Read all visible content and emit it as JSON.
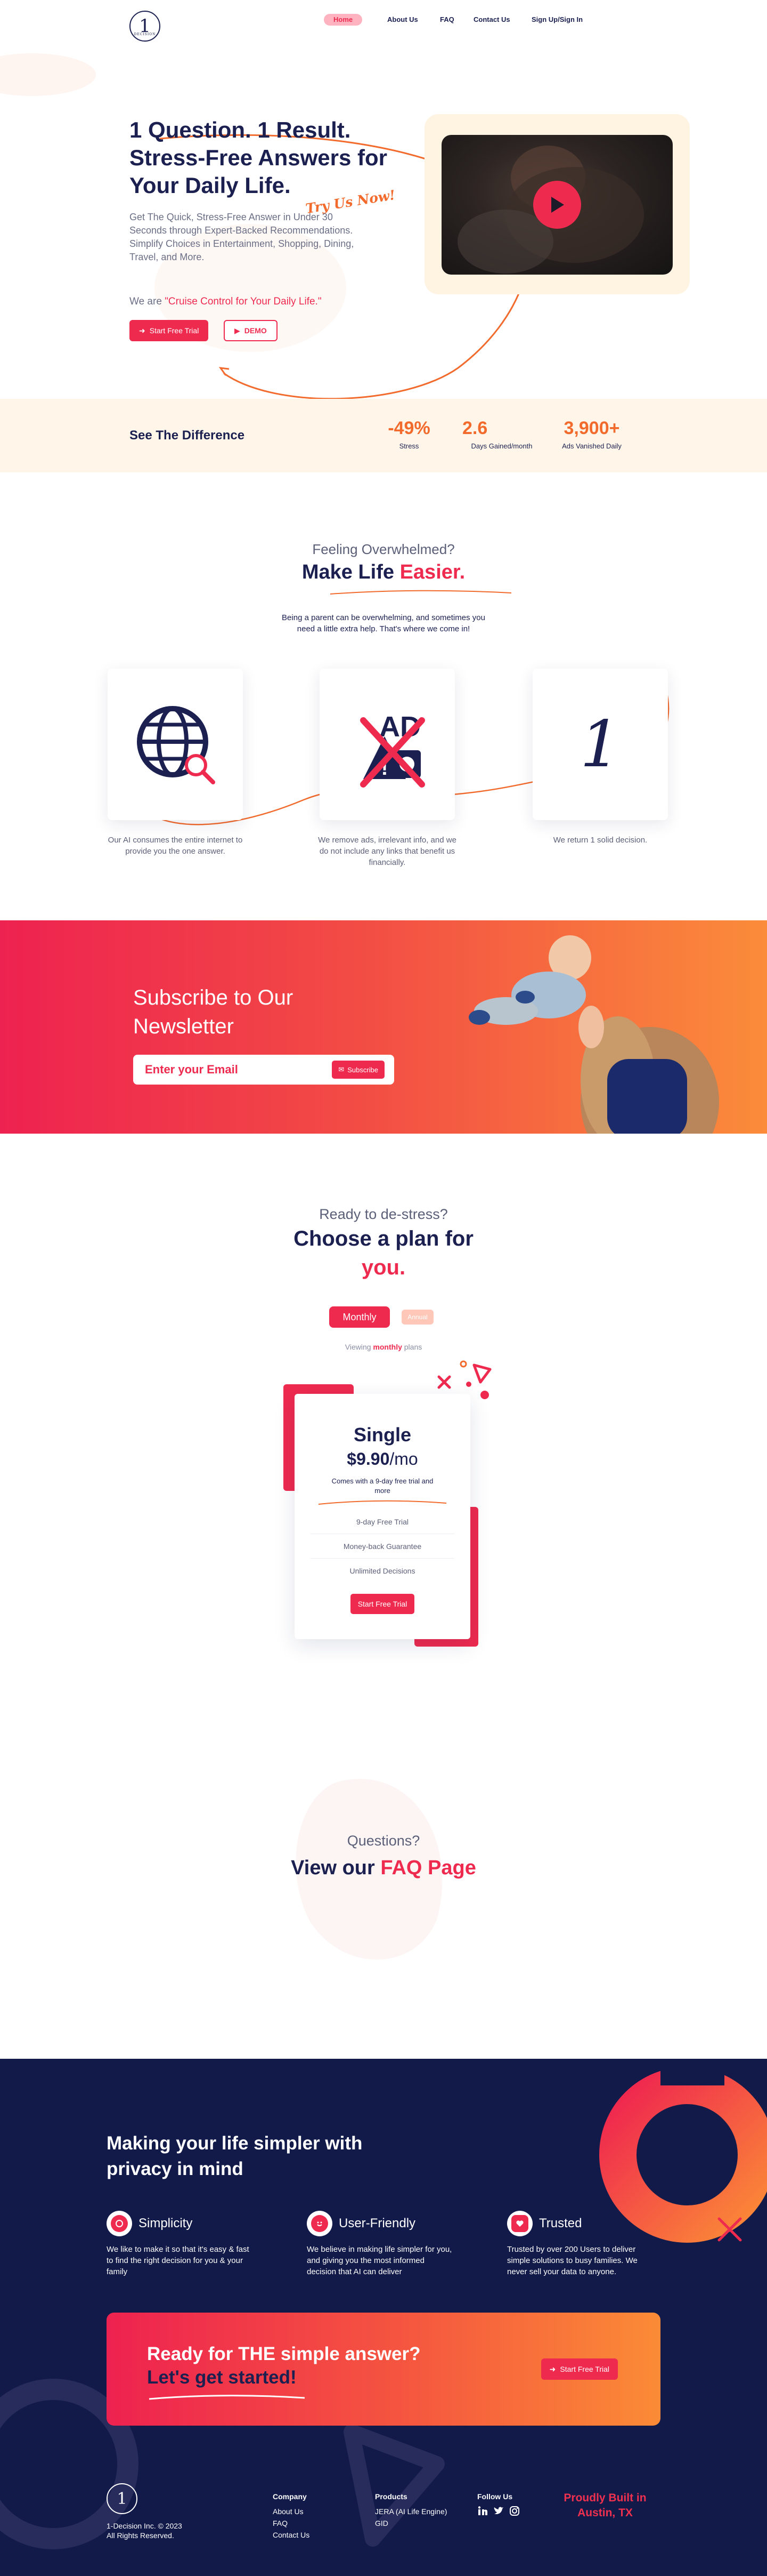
{
  "nav": {
    "logo_text": "1",
    "logo_sub": "DECISION",
    "links": [
      "Home",
      "About Us",
      "FAQ",
      "Contact Us",
      "Sign Up/Sign In"
    ]
  },
  "hero": {
    "title": "1 Question. 1 Result. Stress-Free Answers for Your Daily Life.",
    "try_us": "Try Us Now!",
    "description": "Get The Quick, Stress-Free Answer in Under 30 Seconds through Expert-Backed Recommendations. Simplify Choices in Entertainment, Shopping, Dining, Travel, and More.",
    "cruise_prefix": "We are",
    "cruise_highlight": "\"Cruise Control for Your Daily Life.\"",
    "trial_button": "Start Free Trial",
    "demo_button": "DEMO"
  },
  "difference": {
    "title": "See The Difference",
    "stats": [
      {
        "value": "-49%",
        "label": "Stress"
      },
      {
        "value": "2.6",
        "label": "Days Gained/month"
      },
      {
        "value": "3,900+",
        "label": "Ads Vanished Daily"
      }
    ]
  },
  "overwhelmed": {
    "subtitle": "Feeling Overwhelmed?",
    "title_prefix": "Make Life",
    "title_highlight": "Easier.",
    "description_line1": "Being a parent can be overwhelming, and sometimes you",
    "description_line2": "need a little extra help. That's where we come in!",
    "cards": [
      {
        "icon": "globe-search-icon",
        "caption": "Our AI consumes the entire internet to provide you the one answer."
      },
      {
        "icon": "no-ads-icon",
        "caption": "We remove ads, irrelevant info, and we do not include any links that benefit us financially."
      },
      {
        "icon": "number-one-icon",
        "glyph": "1",
        "caption": "We return 1 solid decision."
      }
    ]
  },
  "newsletter": {
    "title": "Subscribe to Our Newsletter",
    "input_placeholder": "Enter your Email",
    "button": "Subscribe"
  },
  "pricing": {
    "subtitle": "Ready to de-stress?",
    "title_prefix": "Choose a plan for",
    "title_highlight": "you.",
    "toggle_monthly": "Monthly",
    "toggle_annual": "Annual",
    "viewing_prefix": "Viewing",
    "viewing_highlight": "monthly",
    "viewing_suffix": "plans",
    "plan": {
      "name": "Single",
      "price": "$9.90",
      "period": "/mo",
      "note": "Comes with a 9-day free trial and more",
      "features": [
        "9-day Free Trial",
        "Money-back Guarantee",
        "Unlimited Decisions"
      ],
      "button": "Start Free Trial"
    }
  },
  "faq": {
    "subtitle": "Questions?",
    "title_prefix": "View our",
    "title_highlight": "FAQ Page"
  },
  "footer": {
    "title": "Making your life simpler with privacy in mind",
    "features": [
      {
        "icon": "brain-icon",
        "title": "Simplicity",
        "desc": "We like to make it so that it's easy & fast to find the right decision for you & your family"
      },
      {
        "icon": "smiley-icon",
        "title": "User-Friendly",
        "desc": "We believe in making life simpler for you, and giving you the most informed decision that AI can deliver"
      },
      {
        "icon": "heart-icon",
        "title": "Trusted",
        "desc": "Trusted by over 200 Users to deliver simple solutions to busy families. We never sell your data to anyone."
      }
    ],
    "cta_line1": "Ready for THE simple answer?",
    "cta_line2": "Let's get started!",
    "cta_button": "Start Free Trial",
    "logo_text": "1",
    "copyright_line1": "1-Decision Inc. © 2023",
    "copyright_line2": "All Rights Reserved.",
    "company_title": "Company",
    "company_links": [
      "About Us",
      "FAQ",
      "Contact Us"
    ],
    "products_title": "Products",
    "product_links": [
      "JERA (AI Life Engine)",
      "GID"
    ],
    "follow_title": "Follow Us",
    "social_icons": [
      "linkedin-icon",
      "twitter-icon",
      "instagram-icon"
    ],
    "built_line1": "Proudly Built in",
    "built_line2": "Austin, TX"
  },
  "colors": {
    "navy": "#1b2050",
    "brand_red": "#ee2a4f",
    "orange": "#f26a2c",
    "cream": "#fff6e9",
    "footer_bg": "#121a4a"
  }
}
